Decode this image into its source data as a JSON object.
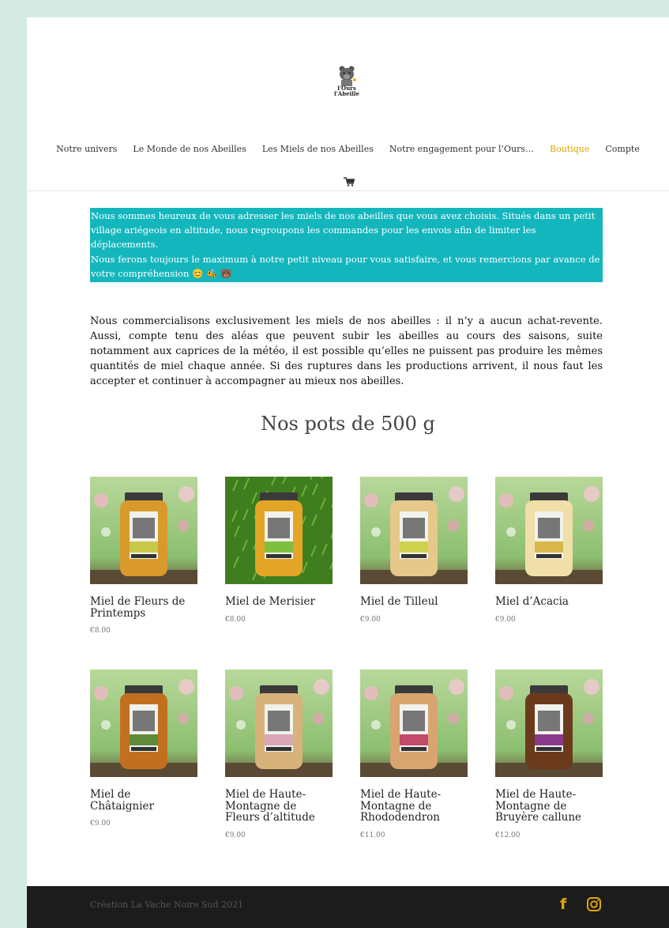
{
  "brand": {
    "logo_text": "l'Ours l'Abeille"
  },
  "nav": {
    "items": [
      {
        "label": "Notre univers",
        "active": false
      },
      {
        "label": "Le Monde de nos Abeilles",
        "active": false
      },
      {
        "label": "Les Miels de nos Abeilles",
        "active": false
      },
      {
        "label": "Notre engagement pour l’Ours…",
        "active": false
      },
      {
        "label": "Boutique",
        "active": true
      },
      {
        "label": "Compte",
        "active": false
      }
    ],
    "cart_icon": "shopping-cart-icon"
  },
  "notice": {
    "line1": "Nous sommes heureux de vous adresser les miels de nos abeilles que vous avez choisis. Situés dans un petit village ariégeois en altitude, nous regroupons les commandes pour les envois afin de limiter les déplacements.",
    "line2": "Nous ferons toujours le maximum à notre petit niveau pour vous satisfaire, et vous remercions par avance de votre compréhension 😊 🐝 🐻",
    "background": "#14b6bd"
  },
  "intro": "Nous commercialisons exclusivement les miels de nos abeilles : il n’y a aucun achat-revente. Aussi, compte tenu des aléas que peuvent subir les abeilles au cours des saisons, suite notamment aux caprices de la météo, il est possible qu’elles ne puissent pas produire les mêmes quantités de miel chaque année. Si des ruptures dans les productions arrivent, il nous faut les accepter et continuer à accompagner au mieux nos abeilles.",
  "section_title": "Nos pots de 500 g",
  "products": [
    {
      "name": "Miel de Fleurs de Printemps",
      "price": "€8.00",
      "honey": "#d99a2b",
      "label": "#c8c84a",
      "bg": "grass-flowers"
    },
    {
      "name": "Miel de Merisier",
      "price": "€8.00",
      "honey": "#e3a526",
      "label": "#7fbf3f",
      "bg": "grass"
    },
    {
      "name": "Miel de Tilleul",
      "price": "€9.00",
      "honey": "#e6c88a",
      "label": "#cfd24c",
      "bg": "grass-flowers"
    },
    {
      "name": "Miel d’Acacia",
      "price": "€9.00",
      "honey": "#f0dfa8",
      "label": "#d9b64a",
      "bg": "grass-flowers"
    },
    {
      "name": "Miel de Châtaignier",
      "price": "€9.00",
      "honey": "#c2701f",
      "label": "#5f8a3a",
      "bg": "grass-flowers"
    },
    {
      "name": "Miel de Haute-Montagne de Fleurs d’altitude",
      "price": "€9.00",
      "honey": "#d7b27a",
      "label": "#d9a8b8",
      "bg": "grass-flowers"
    },
    {
      "name": "Miel de Haute-Montagne de Rhododendron",
      "price": "€11.00",
      "honey": "#d8a470",
      "label": "#c24a6a",
      "bg": "grass-flowers"
    },
    {
      "name": "Miel de Haute-Montagne de Bruyère callune",
      "price": "€12.00",
      "honey": "#6b3a1c",
      "label": "#8a3a8a",
      "bg": "grass-flowers"
    }
  ],
  "footer": {
    "credit": "Création La Vache Noire Sud 2021",
    "social": [
      "facebook-icon",
      "instagram-icon"
    ],
    "accent": "#e0a500"
  }
}
